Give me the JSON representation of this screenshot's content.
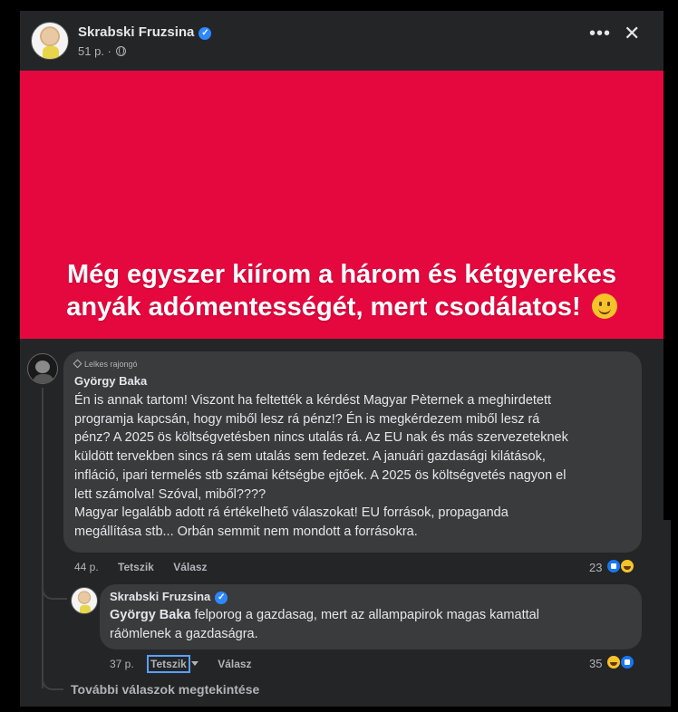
{
  "post": {
    "author": "Skrabski Fruzsina",
    "time": "51 p. ·",
    "image_text": "Még egyszer kiírom a három és kétgyerekes anyák adómentességét, mert csodálatos!",
    "image_bg": "#e5083f"
  },
  "comment": {
    "badge": "Lelkes rajongó",
    "author": "György Baka",
    "lines": [
      "Én is annak tartom! Viszont ha feltették a kérdést Magyar Pèternek a meghirdetett",
      "programja kapcsán, hogy miből lesz rá pénz!? Én is megkérdezem miből lesz rá",
      "pénz? A 2025 ös költségvetésben nincs utalás rá. Az EU nak és más szervezeteknek",
      "küldött tervekben sincs rá sem utalás sem fedezet. A januári gazdasági kilátások,",
      "infláció, ipari termelés stb számai kétségbe ejtőek. A 2025 ös költségvetés nagyon el",
      "lett számolva! Szóval, miből????",
      "Magyar legalább adott rá értékelhető válaszokat! EU források, propaganda",
      "megállítása stb... Orbán semmit nem mondott a forrásokra."
    ],
    "time": "44 p.",
    "like_label": "Tetszik",
    "reply_label": "Válasz",
    "reaction_count": "23"
  },
  "reply": {
    "author": "Skrabski Fruzsina",
    "mention": "György Baka",
    "line1_rest": " felporog a gazdasag, mert az allampapirok magas kamattal",
    "line2": "ráömlenek a gazdaságra.",
    "time": "37 p.",
    "like_label": "Tetszik",
    "reply_label": "Válasz",
    "reaction_count": "35"
  },
  "view_more": "További válaszok megtekintése"
}
